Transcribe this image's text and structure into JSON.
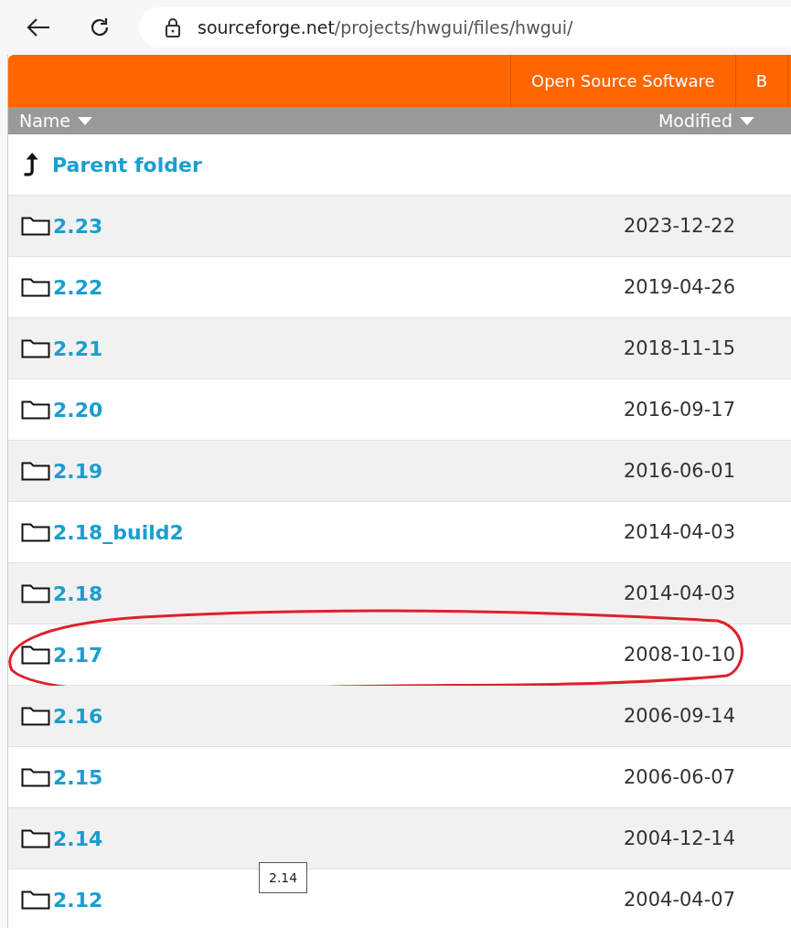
{
  "browser": {
    "url_host": "sourceforge.net",
    "url_path": "/projects/hwgui/files/hwgui/"
  },
  "site_nav": {
    "items": [
      "Open Source Software",
      "B"
    ]
  },
  "table": {
    "columns": [
      "Name",
      "Modified"
    ],
    "parent": {
      "label": "Parent folder"
    },
    "rows": [
      {
        "name": "2.23",
        "modified": "2023-12-22",
        "circled": false
      },
      {
        "name": "2.22",
        "modified": "2019-04-26",
        "circled": false
      },
      {
        "name": "2.21",
        "modified": "2018-11-15",
        "circled": false
      },
      {
        "name": "2.20",
        "modified": "2016-09-17",
        "circled": false
      },
      {
        "name": "2.19",
        "modified": "2016-06-01",
        "circled": false
      },
      {
        "name": "2.18_build2",
        "modified": "2014-04-03",
        "circled": false
      },
      {
        "name": "2.18",
        "modified": "2014-04-03",
        "circled": false
      },
      {
        "name": "2.17",
        "modified": "2008-10-10",
        "circled": true
      },
      {
        "name": "2.16",
        "modified": "2006-09-14",
        "circled": false
      },
      {
        "name": "2.15",
        "modified": "2006-06-07",
        "circled": false
      },
      {
        "name": "2.14",
        "modified": "2004-12-14",
        "circled": false
      },
      {
        "name": "2.12",
        "modified": "2004-04-07",
        "circled": false
      }
    ]
  },
  "tooltip": {
    "text": "2.14"
  }
}
